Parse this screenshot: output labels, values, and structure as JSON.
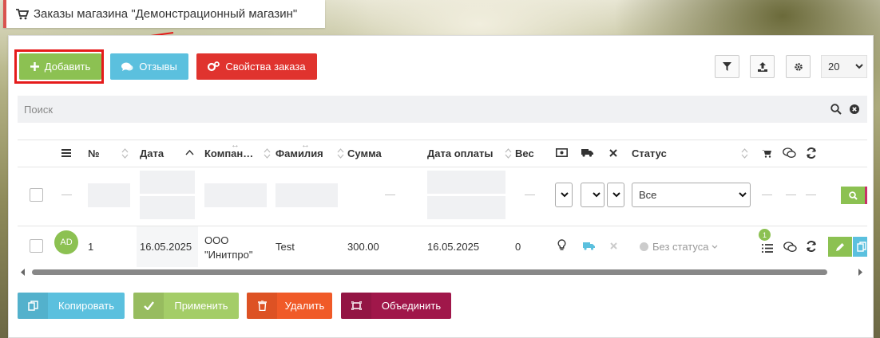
{
  "header": {
    "title": "Заказы магазина \"Демонстрационный магазин\""
  },
  "toolbar": {
    "add_label": "Добавить",
    "reviews_label": "Отзывы",
    "order_props_label": "Свойства заказа",
    "per_page": "20"
  },
  "search": {
    "placeholder": "Поиск"
  },
  "table": {
    "columns": {
      "num": "№",
      "date": "Дата",
      "company": "Компан…",
      "surname": "Фамилия",
      "sum": "Сумма",
      "pay_date": "Дата оплаты",
      "weight": "Вес",
      "status": "Статус"
    },
    "filters": {
      "status_value": "Все",
      "dash": "—"
    },
    "rows": [
      {
        "avatar": "AD",
        "num": "1",
        "date": "16.05.2025",
        "company_line1": "ООО",
        "company_line2": "\"Инитпро\"",
        "surname": "Test",
        "sum": "300.00",
        "pay_date": "16.05.2025",
        "weight": "0",
        "status": "Без статуса",
        "items_count": "1"
      }
    ]
  },
  "footer": {
    "copy_label": "Копировать",
    "apply_label": "Применить",
    "delete_label": "Удалить",
    "merge_label": "Объединить"
  },
  "colors": {
    "green": "#8cc152",
    "blue": "#5bc0de",
    "red": "#e0332e",
    "orange": "#f05a28",
    "maroon": "#a0174a"
  }
}
